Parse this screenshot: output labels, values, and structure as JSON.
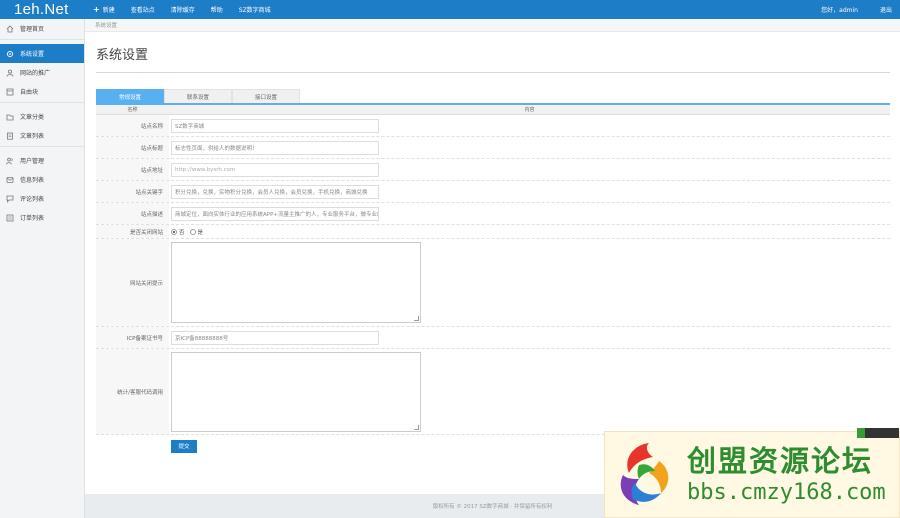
{
  "topbar": {
    "logo": "1eh.Net",
    "nav": [
      {
        "label": "新建",
        "plus": "+"
      },
      {
        "label": "查看站点"
      },
      {
        "label": "清除缓存"
      },
      {
        "label": "帮助"
      },
      {
        "label": "SZ数字商城"
      }
    ],
    "greeting": "您好，admin",
    "logout": "退出"
  },
  "sidebar": {
    "items": [
      {
        "label": "管理首页",
        "icon": "home-icon"
      },
      {
        "label": "系统设置",
        "icon": "gear-icon"
      },
      {
        "label": "网站的推广",
        "icon": "user-icon"
      },
      {
        "label": "自由块",
        "icon": "block-icon"
      },
      {
        "label": "文章分类",
        "icon": "folder-icon"
      },
      {
        "label": "文章列表",
        "icon": "document-icon"
      },
      {
        "label": "用户管理",
        "icon": "users-icon"
      },
      {
        "label": "信息列表",
        "icon": "info-icon"
      },
      {
        "label": "评论列表",
        "icon": "comment-icon"
      },
      {
        "label": "订单列表",
        "icon": "order-icon"
      }
    ]
  },
  "breadcrumb": "系统设置",
  "page_title": "系统设置",
  "tabs": [
    "常规设置",
    "联系设置",
    "接口设置"
  ],
  "table": {
    "col_name": "名称",
    "col_content": "内容"
  },
  "form": {
    "site_name": {
      "label": "站点名称",
      "value": "SZ数字商城"
    },
    "site_title": {
      "label": "站点标题",
      "value": "标志性页面，供给人的数据说明！"
    },
    "site_url": {
      "label": "站点地址",
      "placeholder": "http://www.bysrh.com"
    },
    "site_keywords": {
      "label": "站点关键字",
      "value": "积分兑换，兑换，实物积分兑换，会员人兑换，会员兑换，手机兑换，商城兑换"
    },
    "site_desc": {
      "label": "站点描述",
      "value": "商城定位，面向实体行业的应用系统APP+流量主推广的人，专业服务平台，做专业的推广"
    },
    "site_closed": {
      "label": "是否关闭网站",
      "options": [
        "否",
        "是"
      ],
      "selected": "否"
    },
    "close_notice": {
      "label": "网站关闭提示"
    },
    "icp": {
      "label": "ICP备案证书号",
      "value": "京ICP备88888888号"
    },
    "stats_code": {
      "label": "统计/客服代码调用"
    },
    "submit_label": "提交"
  },
  "footer": "版权所有 © 2017 SZ数字商城 · 并保留所有权利",
  "watermark": {
    "title": "创盟资源论坛",
    "url": "bbs.cmzy168.com"
  }
}
